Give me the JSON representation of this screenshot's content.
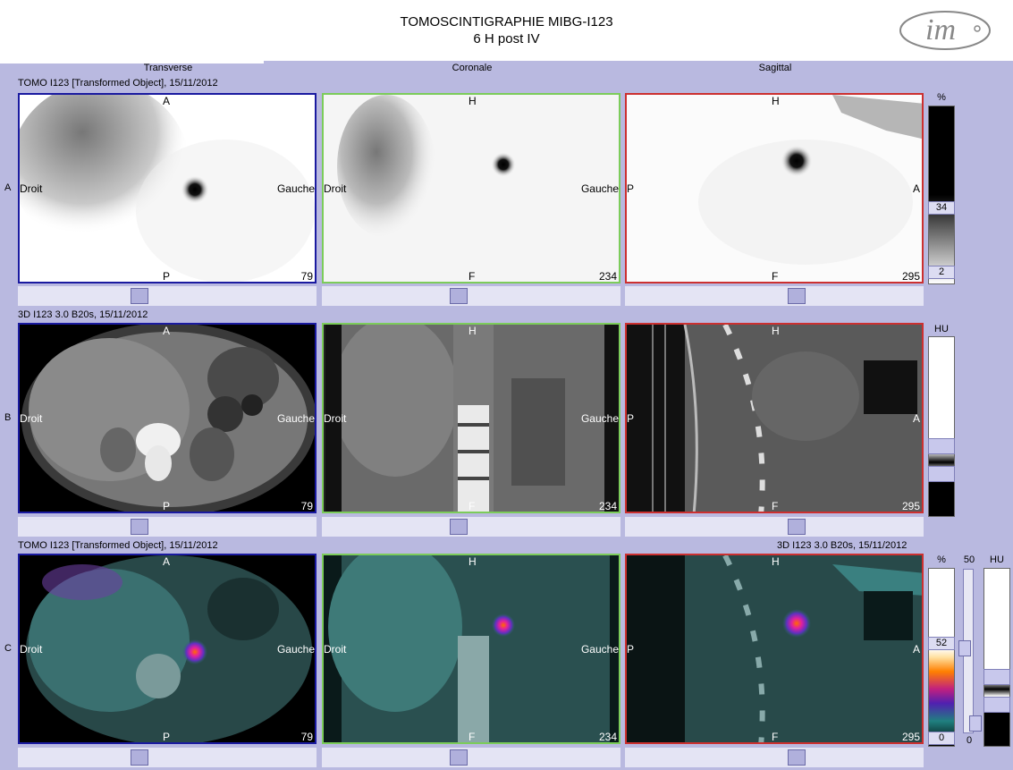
{
  "header": {
    "title_line1": "TOMOSCINTIGRAPHIE MIBG-I123",
    "title_line2": "6 H post IV",
    "logo_text": "im"
  },
  "columns": [
    "Transverse",
    "Coronale",
    "Sagittal"
  ],
  "rows": {
    "A": {
      "label": "A",
      "series": "TOMO I123 [Transformed Object], 15/11/2012"
    },
    "B": {
      "label": "B",
      "series": "3D I123  3.0  B20s, 15/11/2012"
    },
    "C": {
      "label": "C",
      "series_left": "TOMO I123 [Transformed Object], 15/11/2012",
      "series_right": "3D I123  3.0  B20s, 15/11/2012"
    }
  },
  "orient": {
    "transverse": {
      "top": "A",
      "left": "Droit",
      "right": "Gauche",
      "bottom": "P",
      "slice": "79"
    },
    "coronal": {
      "top": "H",
      "left": "Droit",
      "right": "Gauche",
      "bottom": "F",
      "slice": "234"
    },
    "sagittal": {
      "top": "H",
      "left": "P",
      "right": "A",
      "bottom": "F",
      "slice": "295"
    }
  },
  "scales": {
    "a": {
      "unit": "%",
      "max": "34",
      "min": "2"
    },
    "b": {
      "unit": "HU"
    },
    "c": {
      "unit_pct": "%",
      "unit_hu": "HU",
      "blend": "50",
      "blend_min": "0",
      "max": "52",
      "min": "0"
    }
  },
  "colors": {
    "transverse_border": "#1a1aa0",
    "coronal_border": "#7ccc5a",
    "sagittal_border": "#cc3030",
    "accent": "#b9b9e0"
  }
}
